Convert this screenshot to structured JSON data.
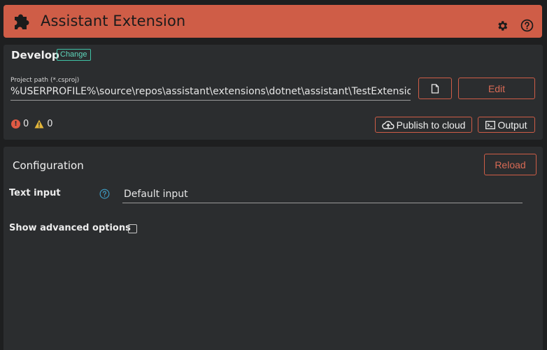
{
  "header": {
    "title": "Assistant Extension",
    "icons": {
      "logo": "puzzle-piece-icon",
      "settings": "gear-icon",
      "help": "help-circle-icon"
    },
    "bg_color": "#cf5d47"
  },
  "develop": {
    "title": "Develop",
    "change_label": "Change",
    "path_label": "Project path (*.csproj)",
    "path_value": "%USERPROFILE%\\source\\repos\\assistant\\extensions\\dotnet\\assistant\\TestExtension\\TestExtension.csproj",
    "file_icon": "file-icon",
    "edit_label": "Edit",
    "errors": "0",
    "warnings": "0",
    "publish_label": "Publish to cloud",
    "output_label": "Output"
  },
  "configuration": {
    "title": "Configuration",
    "reload_label": "Reload",
    "text_input_label": "Text input",
    "text_input_value": "Default input",
    "advanced_label": "Show advanced options",
    "advanced_checked": false
  },
  "colors": {
    "accent": "#cf5d47",
    "teal": "#3fc3a6",
    "panel": "#2b2d2f",
    "bg": "#1e1f20"
  }
}
